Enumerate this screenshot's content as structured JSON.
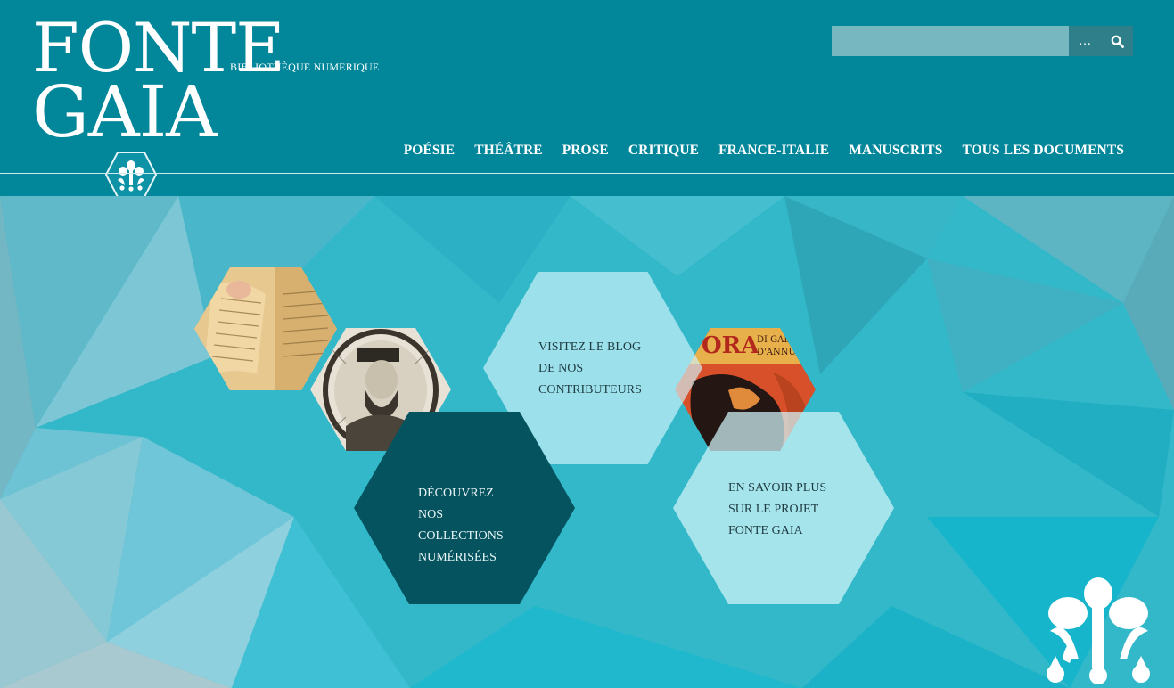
{
  "header": {
    "logo": {
      "line1": "FONTE",
      "line2": "GAIA"
    },
    "tagline": "BIBLIOTHÈQUE NUMERIQUE",
    "search": {
      "placeholder": "",
      "more_label": "…",
      "icon": "search-icon"
    },
    "nav": [
      "POÉSIE",
      "THÉÂTRE",
      "PROSE",
      "CRITIQUE",
      "FRANCE-ITALIE",
      "MANUSCRITS",
      "TOUS LES DOCUMENTS"
    ]
  },
  "hero": {
    "tiles": {
      "blog": [
        "VISITEZ LE BLOG",
        "DE NOS",
        "CONTRIBUTEURS"
      ],
      "collections": [
        "DÉCOUVREZ",
        "NOS",
        "COLLECTIONS",
        "NUMÉRISÉES"
      ],
      "projet": [
        "EN SAVOIR PLUS",
        "SUR LE PROJET",
        "FONTE GAIA"
      ]
    },
    "images": [
      "manuscript-image",
      "engraved-portrait-image",
      "poster-image"
    ]
  },
  "colors": {
    "header_bg": "#02869a",
    "hero_bg": "#1fb6c9",
    "dark_tile": "#04535e",
    "search_button": "#2e7f89"
  }
}
